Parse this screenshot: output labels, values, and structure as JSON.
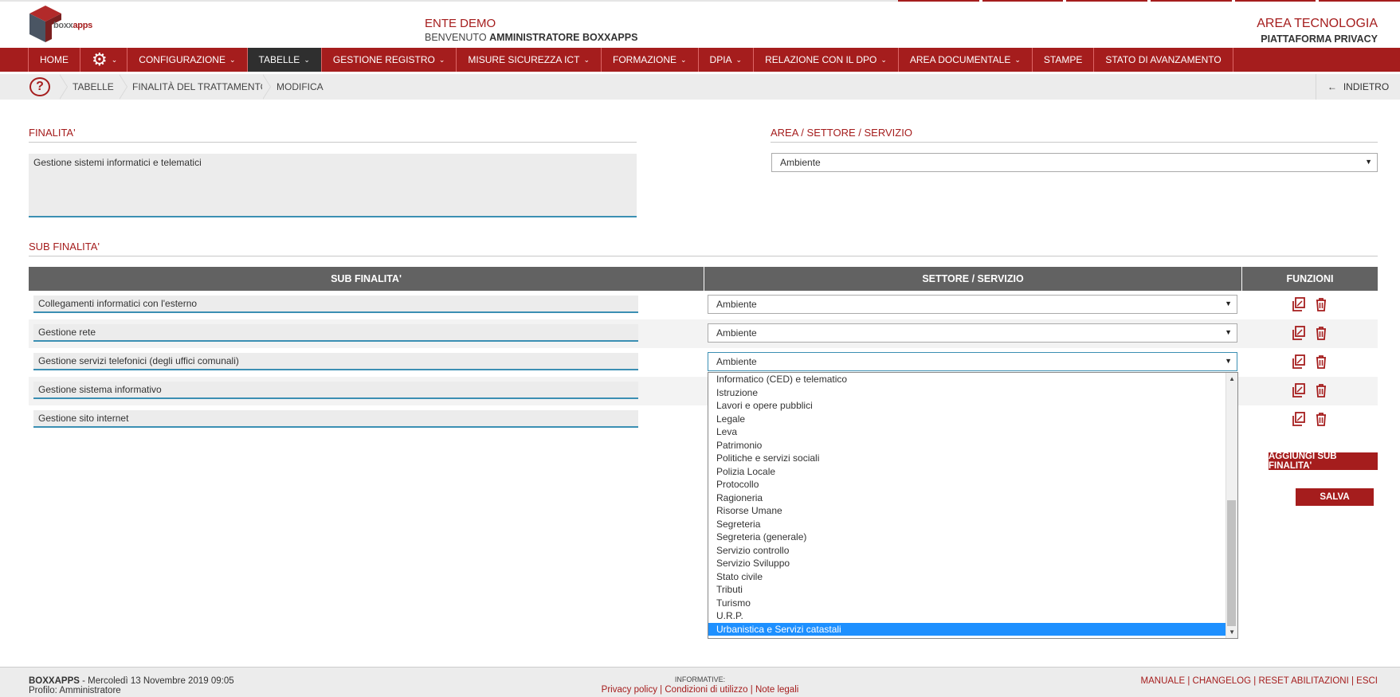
{
  "header": {
    "logo_text_prefix": "boxx",
    "logo_text_suffix": "apps",
    "ente": "ENTE DEMO",
    "welcome_prefix": "BENVENUTO",
    "welcome_user": "AMMINISTRATORE BOXXAPPS",
    "area": "AREA TECNOLOGIA",
    "platform": "PIATTAFORMA PRIVACY"
  },
  "nav": {
    "items": [
      {
        "label": "HOME"
      },
      {
        "label": "CONFIGURAZIONE"
      },
      {
        "label": "TABELLE"
      },
      {
        "label": "GESTIONE REGISTRO"
      },
      {
        "label": "MISURE SICUREZZA ICT"
      },
      {
        "label": "FORMAZIONE"
      },
      {
        "label": "DPIA"
      },
      {
        "label": "RELAZIONE CON IL DPO"
      },
      {
        "label": "AREA DOCUMENTALE"
      },
      {
        "label": "STAMPE"
      },
      {
        "label": "STATO DI AVANZAMENTO"
      }
    ],
    "gear_icon": "gear-icon",
    "active": "TABELLE"
  },
  "breadcrumb": {
    "items": [
      "TABELLE",
      "FINALITÀ DEL TRATTAMENTO",
      "MODIFICA"
    ],
    "back_label": "INDIETRO"
  },
  "form": {
    "finalita_title": "FINALITA'",
    "finalita_value": "Gestione sistemi informatici e telematici",
    "area_title": "AREA / SETTORE / SERVIZIO",
    "area_value": "Ambiente",
    "sub_title": "SUB FINALITA'"
  },
  "table": {
    "headers": [
      "SUB FINALITA'",
      "SETTORE / SERVIZIO",
      "FUNZIONI"
    ],
    "rows": [
      {
        "sub": "Collegamenti informatici con l'esterno",
        "settore": "Ambiente"
      },
      {
        "sub": "Gestione rete",
        "settore": "Ambiente"
      },
      {
        "sub": "Gestione servizi telefonici (degli uffici comunali)",
        "settore": "Ambiente"
      },
      {
        "sub": "Gestione sistema informativo",
        "settore": ""
      },
      {
        "sub": "Gestione sito internet",
        "settore": ""
      }
    ]
  },
  "dropdown": {
    "options": [
      "Informatico (CED) e telematico",
      "Istruzione",
      "Lavori e opere pubblici",
      "Legale",
      "Leva",
      "Patrimonio",
      "Politiche e servizi sociali",
      "Polizia Locale",
      "Protocollo",
      "Ragioneria",
      "Risorse Umane",
      "Segreteria",
      "Segreteria (generale)",
      "Servizio controllo",
      "Servizio Sviluppo",
      "Stato civile",
      "Tributi",
      "Turismo",
      "U.R.P.",
      "Urbanistica e Servizi catastali"
    ],
    "selected": "Urbanistica e Servizi catastali"
  },
  "buttons": {
    "add_label": "AGGIUNGI SUB FINALITA'",
    "save_label": "SALVA"
  },
  "footer": {
    "brand": "BOXXAPPS",
    "datetime": " - Mercoledì 13 Novembre 2019 09:05",
    "profile": "Profilo: Amministratore",
    "informative_label": "INFORMATIVE:",
    "privacy": "Privacy policy",
    "conditions": "Condizioni di utilizzo",
    "legal": "Note legali",
    "manuale": "MANUALE",
    "changelog": "CHANGELOG",
    "reset": "RESET ABILITAZIONI",
    "esci": "ESCI"
  },
  "colors": {
    "brand_red": "#a51d1d",
    "nav_active": "#2f2f2f",
    "table_header": "#626262",
    "input_underline": "#3b8fb3",
    "selected_option": "#1e90ff"
  }
}
